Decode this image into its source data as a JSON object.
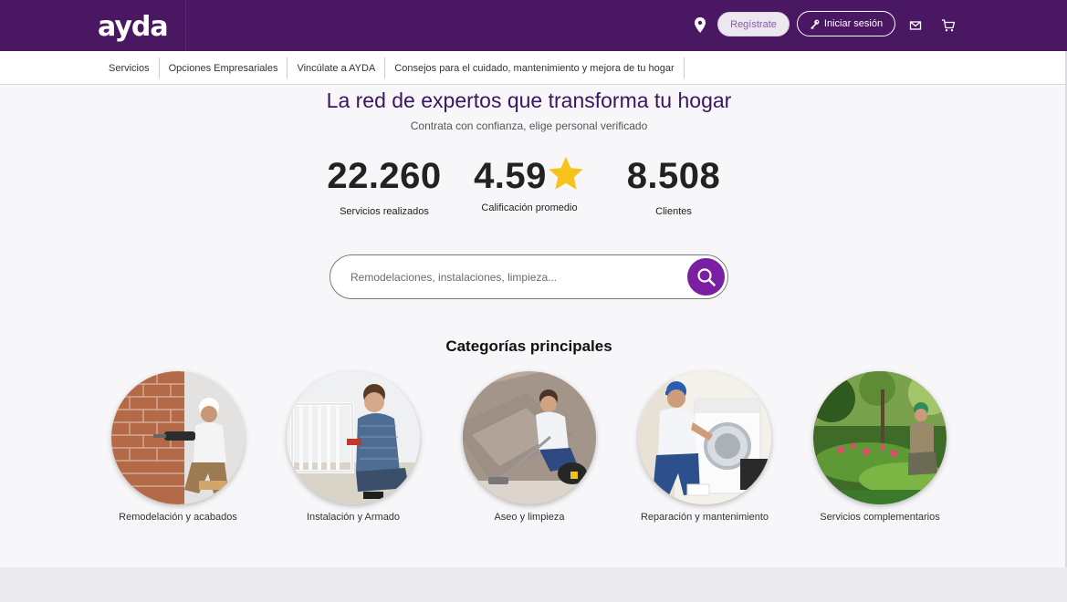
{
  "header": {
    "logo_text": "ayda",
    "register_label": "Regístrate",
    "login_label": "Iniciar sesión",
    "icons": [
      "location-pin-icon",
      "key-icon",
      "mail-icon",
      "cart-icon"
    ],
    "background_color": "#4a1762"
  },
  "subnav": {
    "items": [
      {
        "label": "Servicios"
      },
      {
        "label": "Opciones Empresariales"
      },
      {
        "label": "Vincúlate a AYDA"
      },
      {
        "label": "Consejos para el cuidado, mantenimiento y mejora de tu hogar"
      }
    ]
  },
  "hero": {
    "title": "La red de expertos que transforma tu hogar",
    "subtitle": "Contrata con confianza, elige personal verificado"
  },
  "stats": [
    {
      "value": "22.260",
      "label": "Servicios realizados"
    },
    {
      "value": "4.59",
      "label": "Calificación promedio",
      "icon": "star-icon"
    },
    {
      "value": "8.508",
      "label": "Clientes"
    }
  ],
  "search": {
    "placeholder": "Remodelaciones, instalaciones, limpieza...",
    "button_icon": "search-icon",
    "accent_color": "#7b1fa2"
  },
  "categories": {
    "heading": "Categorías principales",
    "items": [
      {
        "label": "Remodelación y acabados",
        "image": "worker-drilling-brick-wall"
      },
      {
        "label": "Instalación y Armado",
        "image": "man-assembling-crib"
      },
      {
        "label": "Aseo y limpieza",
        "image": "worker-vacuuming-sofa"
      },
      {
        "label": "Reparación y mantenimiento",
        "image": "technician-repairing-washer"
      },
      {
        "label": "Servicios complementarios",
        "image": "gardener-in-garden"
      }
    ]
  }
}
